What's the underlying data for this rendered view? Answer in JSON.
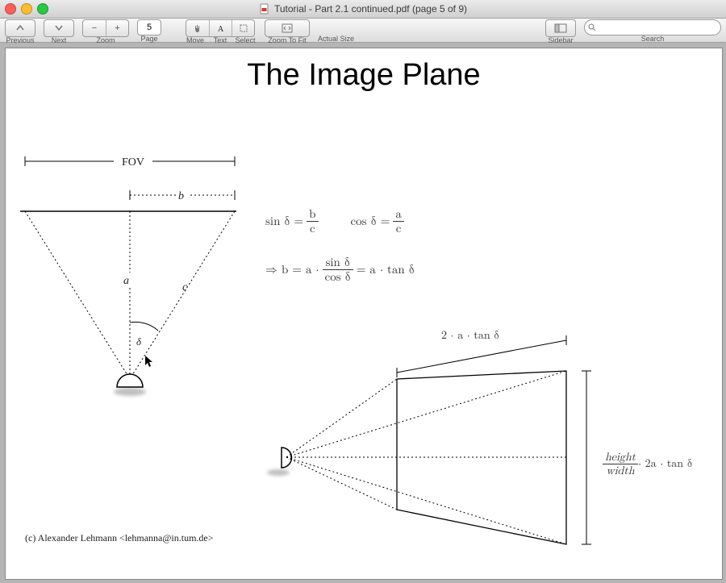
{
  "window": {
    "title": "Tutorial - Part 2.1 continued.pdf (page 5 of 9)"
  },
  "toolbar": {
    "previous": "Previous",
    "next": "Next",
    "zoom": "Zoom",
    "page": "Page",
    "page_value": "5",
    "move": "Move",
    "text": "Text",
    "select": "Select",
    "zoom_to_fit": "Zoom To Fit",
    "actual_size": "Actual Size",
    "sidebar": "Sidebar",
    "search": "Search",
    "search_placeholder": ""
  },
  "document": {
    "heading": "The Image Plane",
    "fov_label": "FOV",
    "label_a": "a",
    "label_b": "b",
    "label_c": "c",
    "label_delta": "δ",
    "eq_sin": "sin δ =",
    "eq_cos": "cos δ =",
    "frac_b": "b",
    "frac_c": "c",
    "frac_a": "a",
    "eq2_arrow": "⇒ b = a · ",
    "eq2_numer": "sin δ",
    "eq2_denom": "cos δ",
    "eq2_tail": " = a · tan δ",
    "top_measure": "2 · a · tan δ",
    "ratio_num": "height",
    "ratio_den": "width",
    "ratio_tail": " · 2a · tan δ",
    "copyright": "(c) Alexander Lehmann <lehmanna@in.tum.de>"
  }
}
